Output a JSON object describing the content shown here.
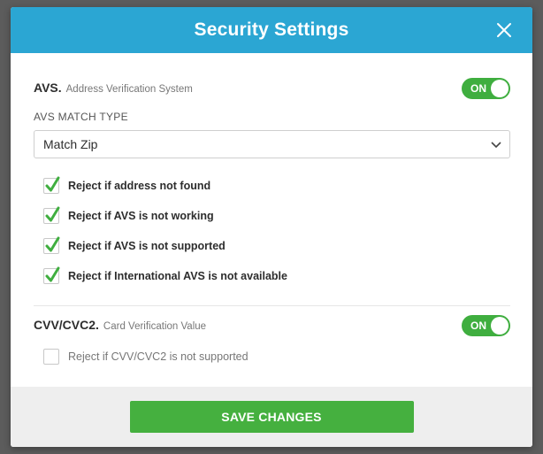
{
  "modal": {
    "title": "Security Settings",
    "close_icon": "close-icon"
  },
  "avs": {
    "title": "AVS.",
    "subtitle": "Address Verification System",
    "toggle_label": "ON",
    "toggle_on": true,
    "match_type_label": "AVS MATCH TYPE",
    "match_type_value": "Match Zip",
    "options": [
      {
        "label": "Reject if address not found",
        "checked": true
      },
      {
        "label": "Reject if AVS is not working",
        "checked": true
      },
      {
        "label": "Reject if AVS is not supported",
        "checked": true
      },
      {
        "label": "Reject if International AVS is not available",
        "checked": true
      }
    ]
  },
  "cvv": {
    "title": "CVV/CVC2.",
    "subtitle": "Card Verification Value",
    "toggle_label": "ON",
    "toggle_on": true,
    "options": [
      {
        "label": "Reject if CVV/CVC2 is not supported",
        "checked": false
      }
    ]
  },
  "footer": {
    "save_label": "SAVE CHANGES"
  },
  "colors": {
    "header": "#2ba6d3",
    "toggle_on": "#3fae3f",
    "check": "#3fae3f",
    "save_button": "#45b03f",
    "footer_bg": "#eeeeee",
    "overlay": "#5c5c5c"
  }
}
